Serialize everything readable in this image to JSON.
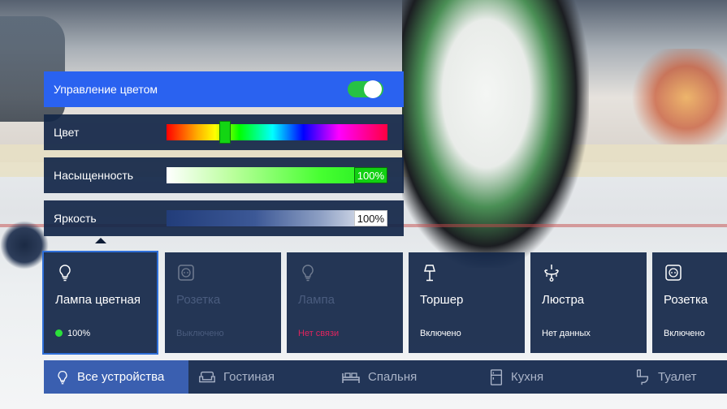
{
  "color_control": {
    "title": "Управление цветом",
    "enabled": true
  },
  "sliders": [
    {
      "label": "Цвет",
      "hue_position": 0.25
    },
    {
      "label": "Насыщенность",
      "value_text": "100%",
      "value": 1.0
    },
    {
      "label": "Яркость",
      "value_text": "100%",
      "value": 1.0
    }
  ],
  "devices": [
    {
      "name": "Лампа цветная",
      "status": "100%",
      "icon": "bulb-icon",
      "state": "on-selected"
    },
    {
      "name": "Розетка",
      "status": "Выключено",
      "icon": "outlet-icon",
      "state": "disabled"
    },
    {
      "name": "Лампа",
      "status": "Нет связи",
      "icon": "bulb-icon",
      "state": "disconnected"
    },
    {
      "name": "Торшер",
      "status": "Включено",
      "icon": "floor-lamp-icon",
      "state": "on"
    },
    {
      "name": "Люстра",
      "status": "Нет данных",
      "icon": "chandelier-icon",
      "state": "unknown"
    },
    {
      "name": "Розетка",
      "status": "Включено",
      "icon": "outlet-icon",
      "state": "on"
    }
  ],
  "rooms": [
    {
      "label": "Все устройства",
      "icon": "bulb-icon",
      "active": true
    },
    {
      "label": "Гостиная",
      "icon": "sofa-icon",
      "active": false
    },
    {
      "label": "Спальня",
      "icon": "bed-icon",
      "active": false
    },
    {
      "label": "Кухня",
      "icon": "fridge-icon",
      "active": false
    },
    {
      "label": "Туалет",
      "icon": "toilet-icon",
      "active": false
    }
  ],
  "colors": {
    "accent": "#2a62f0",
    "panel": "#122648",
    "toggle_on": "#27c244",
    "status_ok": "#2be03a",
    "status_error": "#e0245e"
  }
}
